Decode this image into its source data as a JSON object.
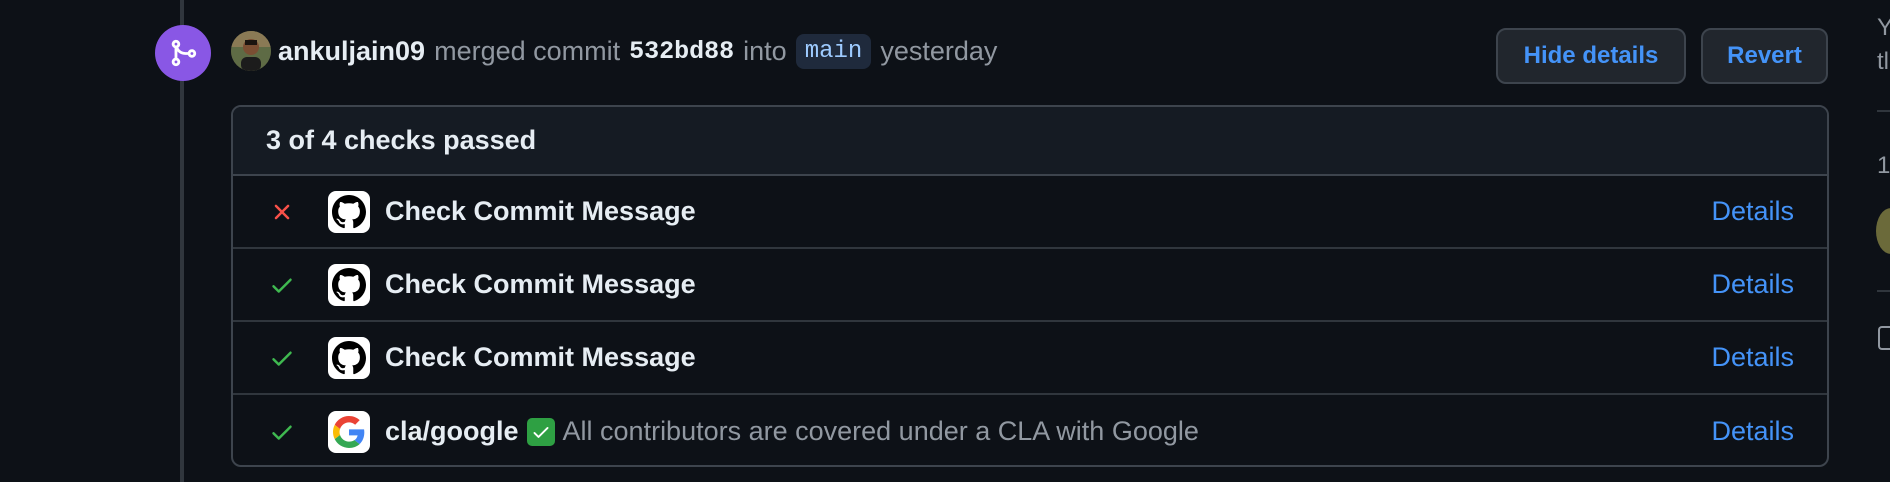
{
  "event": {
    "author": "ankuljain09",
    "action": "merged commit",
    "sha": "532bd88",
    "into_label": "into",
    "branch": "main",
    "when": "yesterday"
  },
  "buttons": {
    "hide_details": "Hide details",
    "revert": "Revert"
  },
  "checks": {
    "summary": "3 of 4 checks passed",
    "items": [
      {
        "status": "failed",
        "app": "github",
        "name": "Check Commit Message",
        "description": "",
        "details": "Details"
      },
      {
        "status": "passed",
        "app": "github",
        "name": "Check Commit Message",
        "description": "",
        "details": "Details"
      },
      {
        "status": "passed",
        "app": "github",
        "name": "Check Commit Message",
        "description": "",
        "details": "Details"
      },
      {
        "status": "passed",
        "app": "google",
        "name": "cla/google",
        "description": "All contributors are covered under a CLA with Google",
        "details": "Details"
      }
    ]
  },
  "sidebar_fragments": {
    "line1": "Y",
    "line2": "tl",
    "line3": "1"
  },
  "colors": {
    "accent": "#4493f8",
    "merged": "#8957e5",
    "success": "#3fb950",
    "danger": "#f85149"
  }
}
